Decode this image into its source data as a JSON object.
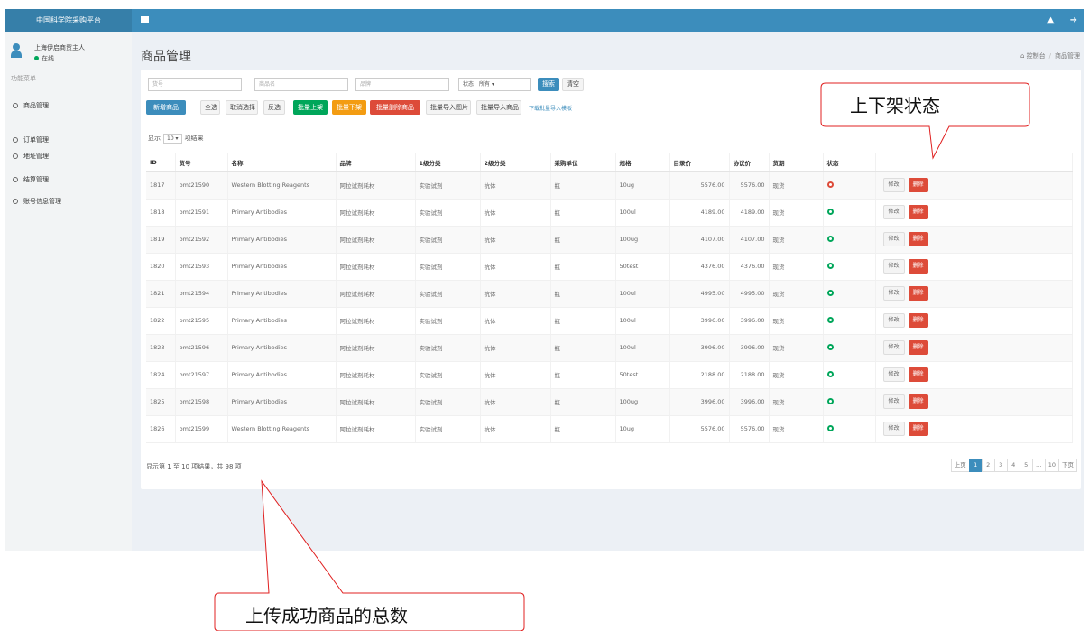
{
  "app": {
    "title": "中国科学院采购平台"
  },
  "topbar": {
    "right_icons": [
      "warning-icon",
      "exit-icon"
    ]
  },
  "user": {
    "name": "上海伊启商贸主人",
    "status": "在线"
  },
  "sidebar": {
    "header": "功能菜单",
    "items": [
      {
        "label": "商品管理"
      },
      {
        "label": "订单管理"
      },
      {
        "label": "地址管理"
      },
      {
        "label": "结算管理"
      },
      {
        "label": "账号信息管理"
      }
    ]
  },
  "page": {
    "title": "商品管理",
    "breadcrumb": [
      "控制台",
      "商品管理"
    ]
  },
  "filters": {
    "placeholders": [
      "货号",
      "商品名",
      "品牌"
    ],
    "status_select": "状态：所有",
    "search_label": "搜索",
    "reset_label": "清空"
  },
  "toolbar": {
    "add": "新增商品",
    "select_all": "全选",
    "deselect": "取消选择",
    "invert": "反选",
    "batch_on": "批量上架",
    "batch_off": "批量下架",
    "batch_delete": "批量删除商品",
    "import_images": "批量导入图片",
    "import_products": "批量导入商品",
    "template_link": "下载批量导入模板"
  },
  "entries": {
    "prefix": "显示",
    "value": "10",
    "suffix": "项结果"
  },
  "table": {
    "headers": [
      "ID",
      "货号",
      "名称",
      "品牌",
      "1级分类",
      "2级分类",
      "采购单位",
      "规格",
      "目录价",
      "协议价",
      "货期",
      "状态",
      ""
    ],
    "rows": [
      {
        "id": "1817",
        "sku": "bmt21590",
        "name": "Western Blotting Reagents",
        "brand": "阿拉试剂耗材",
        "cat1": "实验试剂",
        "cat2": "抗体",
        "unit": "瓶",
        "spec": "10ug",
        "list_price": "5576.00",
        "deal_price": "5576.00",
        "lead": "现货",
        "status": "off"
      },
      {
        "id": "1818",
        "sku": "bmt21591",
        "name": "Primary Antibodies",
        "brand": "阿拉试剂耗材",
        "cat1": "实验试剂",
        "cat2": "抗体",
        "unit": "瓶",
        "spec": "100ul",
        "list_price": "4189.00",
        "deal_price": "4189.00",
        "lead": "现货",
        "status": "on"
      },
      {
        "id": "1819",
        "sku": "bmt21592",
        "name": "Primary Antibodies",
        "brand": "阿拉试剂耗材",
        "cat1": "实验试剂",
        "cat2": "抗体",
        "unit": "瓶",
        "spec": "100ug",
        "list_price": "4107.00",
        "deal_price": "4107.00",
        "lead": "现货",
        "status": "on"
      },
      {
        "id": "1820",
        "sku": "bmt21593",
        "name": "Primary Antibodies",
        "brand": "阿拉试剂耗材",
        "cat1": "实验试剂",
        "cat2": "抗体",
        "unit": "瓶",
        "spec": "50test",
        "list_price": "4376.00",
        "deal_price": "4376.00",
        "lead": "现货",
        "status": "on"
      },
      {
        "id": "1821",
        "sku": "bmt21594",
        "name": "Primary Antibodies",
        "brand": "阿拉试剂耗材",
        "cat1": "实验试剂",
        "cat2": "抗体",
        "unit": "瓶",
        "spec": "100ul",
        "list_price": "4995.00",
        "deal_price": "4995.00",
        "lead": "现货",
        "status": "on"
      },
      {
        "id": "1822",
        "sku": "bmt21595",
        "name": "Primary Antibodies",
        "brand": "阿拉试剂耗材",
        "cat1": "实验试剂",
        "cat2": "抗体",
        "unit": "瓶",
        "spec": "100ul",
        "list_price": "3996.00",
        "deal_price": "3996.00",
        "lead": "现货",
        "status": "on"
      },
      {
        "id": "1823",
        "sku": "bmt21596",
        "name": "Primary Antibodies",
        "brand": "阿拉试剂耗材",
        "cat1": "实验试剂",
        "cat2": "抗体",
        "unit": "瓶",
        "spec": "100ul",
        "list_price": "3996.00",
        "deal_price": "3996.00",
        "lead": "现货",
        "status": "on"
      },
      {
        "id": "1824",
        "sku": "bmt21597",
        "name": "Primary Antibodies",
        "brand": "阿拉试剂耗材",
        "cat1": "实验试剂",
        "cat2": "抗体",
        "unit": "瓶",
        "spec": "50test",
        "list_price": "2188.00",
        "deal_price": "2188.00",
        "lead": "现货",
        "status": "on"
      },
      {
        "id": "1825",
        "sku": "bmt21598",
        "name": "Primary Antibodies",
        "brand": "阿拉试剂耗材",
        "cat1": "实验试剂",
        "cat2": "抗体",
        "unit": "瓶",
        "spec": "100ug",
        "list_price": "3996.00",
        "deal_price": "3996.00",
        "lead": "现货",
        "status": "on"
      },
      {
        "id": "1826",
        "sku": "bmt21599",
        "name": "Western Blotting Reagents",
        "brand": "阿拉试剂耗材",
        "cat1": "实验试剂",
        "cat2": "抗体",
        "unit": "瓶",
        "spec": "10ug",
        "list_price": "5576.00",
        "deal_price": "5576.00",
        "lead": "现货",
        "status": "on"
      }
    ],
    "edit_label": "修改",
    "delete_label": "删除"
  },
  "summary": "显示第 1 至 10 项结果，共 98 项",
  "pagination": {
    "prev": "上页",
    "pages": [
      "1",
      "2",
      "3",
      "4",
      "5",
      "…",
      "10"
    ],
    "next": "下页",
    "active": "1"
  },
  "annotations": {
    "status_callout": "上下架状态",
    "total_callout": "上传成功商品的总数"
  },
  "colors": {
    "primary": "#3c8dbc",
    "success": "#00a65a",
    "danger": "#dd4b39",
    "warning": "#f39c12"
  }
}
